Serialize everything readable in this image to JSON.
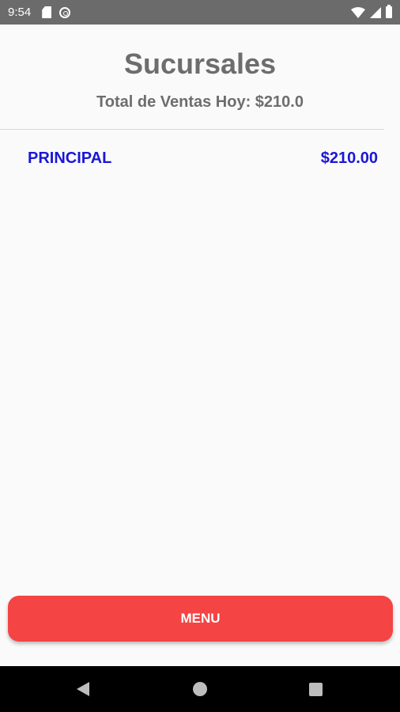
{
  "statusbar": {
    "time": "9:54",
    "icons": [
      "sd-card-icon",
      "sync-icon",
      "wifi-icon",
      "signal-icon",
      "battery-icon"
    ]
  },
  "header": {
    "title": "Sucursales",
    "total_sales": "Total de Ventas Hoy: $210.0"
  },
  "branches": [
    {
      "name": "PRINCIPAL",
      "amount": "$210.00"
    }
  ],
  "footer": {
    "menu_label": "MENU"
  },
  "colors": {
    "statusbar": "#6b6b6b",
    "title_text": "#6d6d6d",
    "branch_text": "#1a17d6",
    "menu_button": "#f44444",
    "navbar": "#000000"
  },
  "navbar": {
    "icons": [
      "back-icon",
      "home-icon",
      "recents-icon"
    ]
  }
}
